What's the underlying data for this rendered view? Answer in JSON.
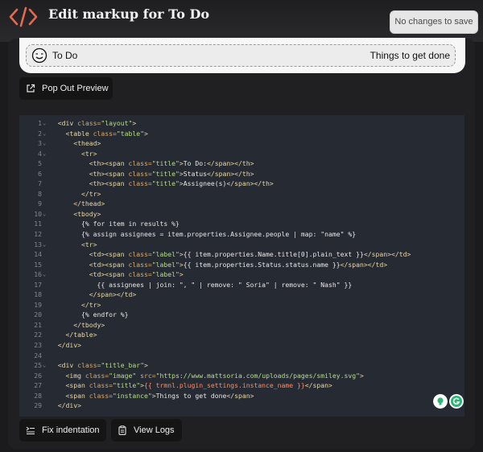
{
  "header": {
    "title": "Edit markup for To Do",
    "save_label": "No changes to save"
  },
  "preview": {
    "title": "To Do",
    "instance": "Things to get done"
  },
  "toolbar": {
    "popout_label": "Pop Out Preview",
    "fix_indent_label": "Fix indentation",
    "view_logs_label": "View Logs"
  },
  "colors": {
    "accent": "#e26a4f",
    "editor_bg": "#262b33",
    "badge_green": "#2bb673"
  },
  "code_lines": [
    {
      "n": "1",
      "fold": true,
      "segs": [
        [
          "t",
          "<div "
        ],
        [
          "a",
          "class="
        ],
        [
          "s",
          "\"layout\""
        ],
        [
          "t",
          ">"
        ]
      ],
      "indent": 2
    },
    {
      "n": "2",
      "fold": true,
      "segs": [
        [
          "t",
          "<table "
        ],
        [
          "a",
          "class="
        ],
        [
          "s",
          "\"table\""
        ],
        [
          "t",
          ">"
        ]
      ],
      "indent": 4
    },
    {
      "n": "3",
      "fold": true,
      "segs": [
        [
          "t",
          "<thead>"
        ]
      ],
      "indent": 6
    },
    {
      "n": "4",
      "fold": true,
      "segs": [
        [
          "t",
          "<tr>"
        ]
      ],
      "indent": 8
    },
    {
      "n": "5",
      "fold": false,
      "segs": [
        [
          "t",
          "<th><span "
        ],
        [
          "a",
          "class="
        ],
        [
          "s",
          "\"title\""
        ],
        [
          "t",
          ">"
        ],
        [
          "p",
          "To Do:"
        ],
        [
          "t",
          "</span></th>"
        ]
      ],
      "indent": 10
    },
    {
      "n": "6",
      "fold": false,
      "segs": [
        [
          "t",
          "<th><span "
        ],
        [
          "a",
          "class="
        ],
        [
          "s",
          "\"title\""
        ],
        [
          "t",
          ">"
        ],
        [
          "p",
          "Status"
        ],
        [
          "t",
          "</span></th>"
        ]
      ],
      "indent": 10
    },
    {
      "n": "7",
      "fold": false,
      "segs": [
        [
          "t",
          "<th><span "
        ],
        [
          "a",
          "class="
        ],
        [
          "s",
          "\"title\""
        ],
        [
          "t",
          ">"
        ],
        [
          "p",
          "Assignee(s)"
        ],
        [
          "t",
          "</span></th>"
        ]
      ],
      "indent": 10
    },
    {
      "n": "8",
      "fold": false,
      "segs": [
        [
          "t",
          "</tr>"
        ]
      ],
      "indent": 8
    },
    {
      "n": "9",
      "fold": false,
      "segs": [
        [
          "t",
          "</thead>"
        ]
      ],
      "indent": 6
    },
    {
      "n": "10",
      "fold": true,
      "segs": [
        [
          "t",
          "<tbody>"
        ]
      ],
      "indent": 6
    },
    {
      "n": "11",
      "fold": false,
      "segs": [
        [
          "p",
          "{% for item in results %}"
        ]
      ],
      "indent": 8
    },
    {
      "n": "12",
      "fold": false,
      "segs": [
        [
          "p",
          "{% assign assignees = item.properties.Assignee.people | map: \"name\" %}"
        ]
      ],
      "indent": 8
    },
    {
      "n": "13",
      "fold": true,
      "segs": [
        [
          "t",
          "<tr>"
        ]
      ],
      "indent": 8
    },
    {
      "n": "14",
      "fold": false,
      "segs": [
        [
          "t",
          "<td><span "
        ],
        [
          "a",
          "class="
        ],
        [
          "s",
          "\"label\""
        ],
        [
          "t",
          ">"
        ],
        [
          "p",
          "{{ item.properties.Name.title[0].plain_text }}"
        ],
        [
          "t",
          "</span></td>"
        ]
      ],
      "indent": 10
    },
    {
      "n": "15",
      "fold": false,
      "segs": [
        [
          "t",
          "<td><span "
        ],
        [
          "a",
          "class="
        ],
        [
          "s",
          "\"label\""
        ],
        [
          "t",
          ">"
        ],
        [
          "p",
          "{{ item.properties.Status.status.name }}"
        ],
        [
          "t",
          "</span></td>"
        ]
      ],
      "indent": 10
    },
    {
      "n": "16",
      "fold": true,
      "segs": [
        [
          "t",
          "<td><span "
        ],
        [
          "a",
          "class="
        ],
        [
          "s",
          "\"label\""
        ],
        [
          "t",
          ">"
        ]
      ],
      "indent": 10
    },
    {
      "n": "17",
      "fold": false,
      "segs": [
        [
          "p",
          "{{ assignees | join: \", \" | remove: \" Soria\" | remove: \" Nash\" }}"
        ]
      ],
      "indent": 12
    },
    {
      "n": "18",
      "fold": false,
      "segs": [
        [
          "t",
          "</span></td>"
        ]
      ],
      "indent": 10
    },
    {
      "n": "19",
      "fold": false,
      "segs": [
        [
          "t",
          "</tr>"
        ]
      ],
      "indent": 8
    },
    {
      "n": "20",
      "fold": false,
      "segs": [
        [
          "p",
          "{% endfor %}"
        ]
      ],
      "indent": 8
    },
    {
      "n": "21",
      "fold": false,
      "segs": [
        [
          "t",
          "</tbody>"
        ]
      ],
      "indent": 6
    },
    {
      "n": "22",
      "fold": false,
      "segs": [
        [
          "t",
          "</table>"
        ]
      ],
      "indent": 4
    },
    {
      "n": "23",
      "fold": false,
      "segs": [
        [
          "t",
          "</div>"
        ]
      ],
      "indent": 2
    },
    {
      "n": "24",
      "fold": false,
      "segs": [],
      "indent": 0
    },
    {
      "n": "25",
      "fold": true,
      "segs": [
        [
          "t",
          "<div "
        ],
        [
          "a",
          "class="
        ],
        [
          "s",
          "\"title_bar\""
        ],
        [
          "t",
          ">"
        ]
      ],
      "indent": 2
    },
    {
      "n": "26",
      "fold": false,
      "segs": [
        [
          "t",
          "<img "
        ],
        [
          "a",
          "class="
        ],
        [
          "s",
          "\"image\""
        ],
        [
          "a",
          " src="
        ],
        [
          "s",
          "\"https://www.mattsoria.com/uploads/pages/smiley.svg\""
        ],
        [
          "t",
          ">"
        ]
      ],
      "indent": 4
    },
    {
      "n": "27",
      "fold": false,
      "segs": [
        [
          "t",
          "<span "
        ],
        [
          "a",
          "class="
        ],
        [
          "s",
          "\"title\""
        ],
        [
          "t",
          ">"
        ],
        [
          "m",
          "{{ trmnl.plugin_settings.instance_name }}"
        ],
        [
          "t",
          "</span>"
        ]
      ],
      "indent": 4
    },
    {
      "n": "28",
      "fold": false,
      "segs": [
        [
          "t",
          "<span "
        ],
        [
          "a",
          "class="
        ],
        [
          "s",
          "\"instance\""
        ],
        [
          "t",
          ">"
        ],
        [
          "p",
          "Things to get done"
        ],
        [
          "t",
          "</span>"
        ]
      ],
      "indent": 4
    },
    {
      "n": "29",
      "fold": false,
      "segs": [
        [
          "t",
          "</div>"
        ]
      ],
      "indent": 2
    }
  ]
}
